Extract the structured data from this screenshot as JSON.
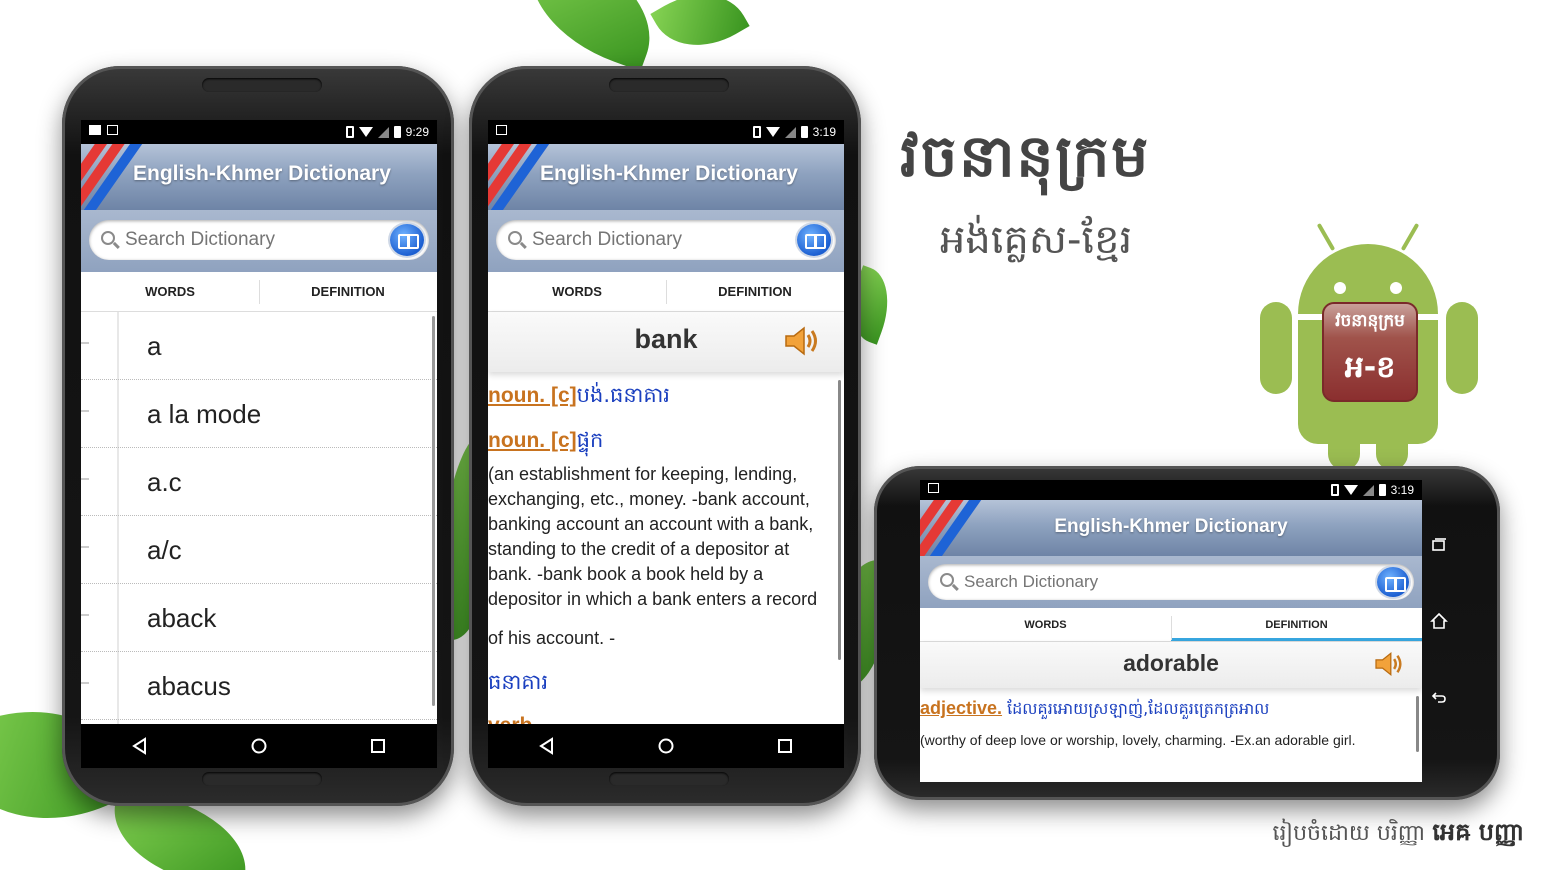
{
  "brand": {
    "title_kh": "វចនានុក្រម",
    "subtitle_kh": "អង់គ្លេស-ខ្មែរ",
    "credit_prefix": "រៀបចំដោយ បរិញ្ញា",
    "credit_name": "អេឝ បញ្ញា",
    "badge_top": "វចនានុក្រម",
    "badge_bottom": "អ-ខ"
  },
  "app": {
    "title": "English-Khmer Dictionary",
    "search_placeholder": "Search Dictionary",
    "tab_words": "WORDS",
    "tab_definition": "DEFINITION"
  },
  "phone1": {
    "time": "9:29",
    "words": [
      "a",
      "a la mode",
      "a.c",
      "a/c",
      "aback",
      "abacus"
    ]
  },
  "phone2": {
    "time": "3:19",
    "word": "bank",
    "def1_pos": "noun. [c]",
    "def1_kh": "បង់.ធនាគារ",
    "def2_pos": "noun. [c]",
    "def2_kh": "ផ្ទុក",
    "def_text": "(an establishment for keeping, lending, exchanging, etc., money. -bank account, banking account an account with a bank, standing to the credit of a depositor at bank. -bank book a book held by a depositor in which a bank enters a record",
    "def_text2": "of his account. -",
    "def3_kh": "ធនាគារ",
    "def4_partial": "verb. ..."
  },
  "phone3": {
    "time": "3:19",
    "word": "adorable",
    "def_pos": "adjective.",
    "def_kh": "ដែលគួរអោយស្រឡាញ់,ដែលគួរត្រេកត្រអាល",
    "def_text": "(worthy of deep love or worship, lovely, charming. -Ex.an adorable girl."
  }
}
